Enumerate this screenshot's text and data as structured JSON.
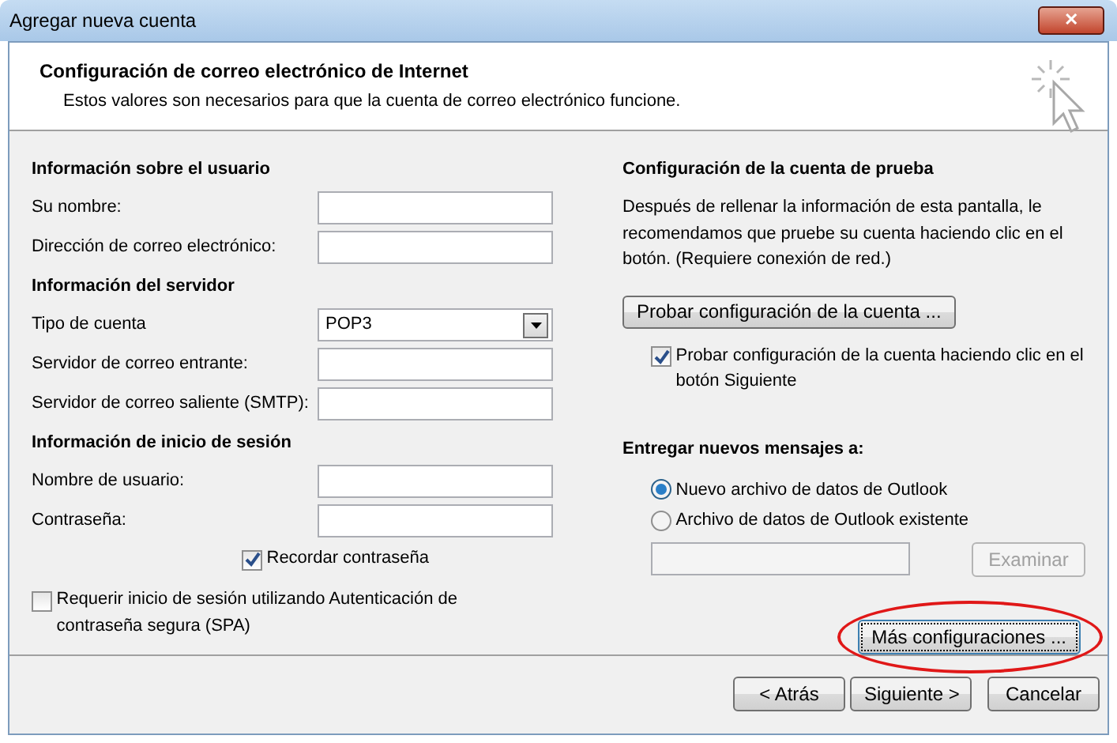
{
  "window": {
    "title": "Agregar nueva cuenta",
    "close": "✕"
  },
  "header": {
    "title": "Configuración de correo electrónico de Internet",
    "subtitle": "Estos valores son necesarios para que la cuenta de correo electrónico funcione."
  },
  "left_sections": [
    {
      "heading": "Información sobre el usuario",
      "fields": [
        {
          "kind": "text",
          "label": "Su nombre:"
        },
        {
          "kind": "text",
          "label": "Dirección de correo electrónico:"
        }
      ]
    },
    {
      "heading": "Información del servidor",
      "fields": [
        {
          "kind": "select",
          "label": "Tipo de cuenta",
          "value": "POP3"
        },
        {
          "kind": "text",
          "label": "Servidor de correo entrante:"
        },
        {
          "kind": "text",
          "label": "Servidor de correo saliente (SMTP):"
        }
      ]
    },
    {
      "heading": "Información de inicio de sesión",
      "fields": [
        {
          "kind": "text",
          "label": "Nombre de usuario:"
        },
        {
          "kind": "text",
          "label": "Contraseña:"
        }
      ]
    }
  ],
  "remember_password": {
    "label": "Recordar contraseña",
    "checked": true
  },
  "spa": {
    "label": "Requerir inicio de sesión utilizando Autenticación de contraseña segura (SPA)",
    "checked": false
  },
  "test": {
    "heading": "Configuración de la cuenta de prueba",
    "description": "Después de rellenar la información de esta pantalla, le recomendamos que pruebe su cuenta haciendo clic en el botón. (Requiere conexión de red.)",
    "button": "Probar configuración de la cuenta ...",
    "on_next": {
      "label": "Probar configuración de la cuenta haciendo clic en el botón Siguiente",
      "checked": true
    }
  },
  "delivery": {
    "heading": "Entregar nuevos mensajes a:",
    "options": [
      {
        "label": "Nuevo archivo de datos de Outlook",
        "selected": true
      },
      {
        "label": "Archivo de datos de Outlook existente",
        "selected": false
      }
    ],
    "browse": {
      "label": "Examinar",
      "disabled": true
    }
  },
  "more_settings": {
    "label": "Más configuraciones ...",
    "circled": true
  },
  "footer_buttons": [
    {
      "label": "< Atrás"
    },
    {
      "label": "Siguiente >"
    },
    {
      "label": "Cancelar"
    }
  ]
}
